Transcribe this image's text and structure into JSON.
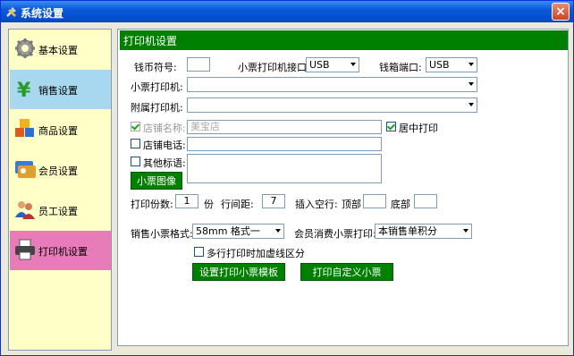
{
  "window": {
    "title": "系统设置",
    "close_glyph": "×"
  },
  "sidebar": {
    "items": [
      {
        "label": "基本设置",
        "icon": "gear-icon"
      },
      {
        "label": "销售设置",
        "icon": "yen-icon"
      },
      {
        "label": "商品设置",
        "icon": "boxes-icon"
      },
      {
        "label": "会员设置",
        "icon": "member-card-icon"
      },
      {
        "label": "员工设置",
        "icon": "staff-icon"
      },
      {
        "label": "打印机设置",
        "icon": "printer-icon"
      }
    ]
  },
  "main": {
    "header": "打印机设置",
    "currency_label": "钱币符号:",
    "currency_value": "",
    "receipt_port_label": "小票打印机接口:",
    "receipt_port_value": "USB",
    "drawer_port_label": "钱箱端口:",
    "drawer_port_value": "USB",
    "receipt_printer_label": "小票打印机:",
    "receipt_printer_value": "",
    "extra_printer_label": "附属打印机:",
    "extra_printer_value": "",
    "store_name_label": "店铺名称:",
    "store_name_value": "美宝店",
    "center_print_label": "居中打印",
    "store_phone_label": "店铺电话:",
    "store_phone_value": "",
    "other_label": "其他标语:",
    "other_value": "",
    "receipt_image_button": "小票图像",
    "copies_label": "打印份数:",
    "copies_value": "1",
    "copies_unit": "份",
    "line_spacing_label": "行间距:",
    "line_spacing_value": "7",
    "insert_blank_label": "插入空行:",
    "top_label": "顶部",
    "top_value": "",
    "bottom_label": "底部",
    "bottom_value": "",
    "sales_format_label": "销售小票格式:",
    "sales_format_value": "58mm 格式一",
    "member_receipt_label": "会员消费小票打印:",
    "member_receipt_value": "本销售单积分",
    "multi_line_label": "多行打印时加虚线区分",
    "set_template_button": "设置打印小票模板",
    "custom_receipt_button": "打印自定义小票"
  }
}
